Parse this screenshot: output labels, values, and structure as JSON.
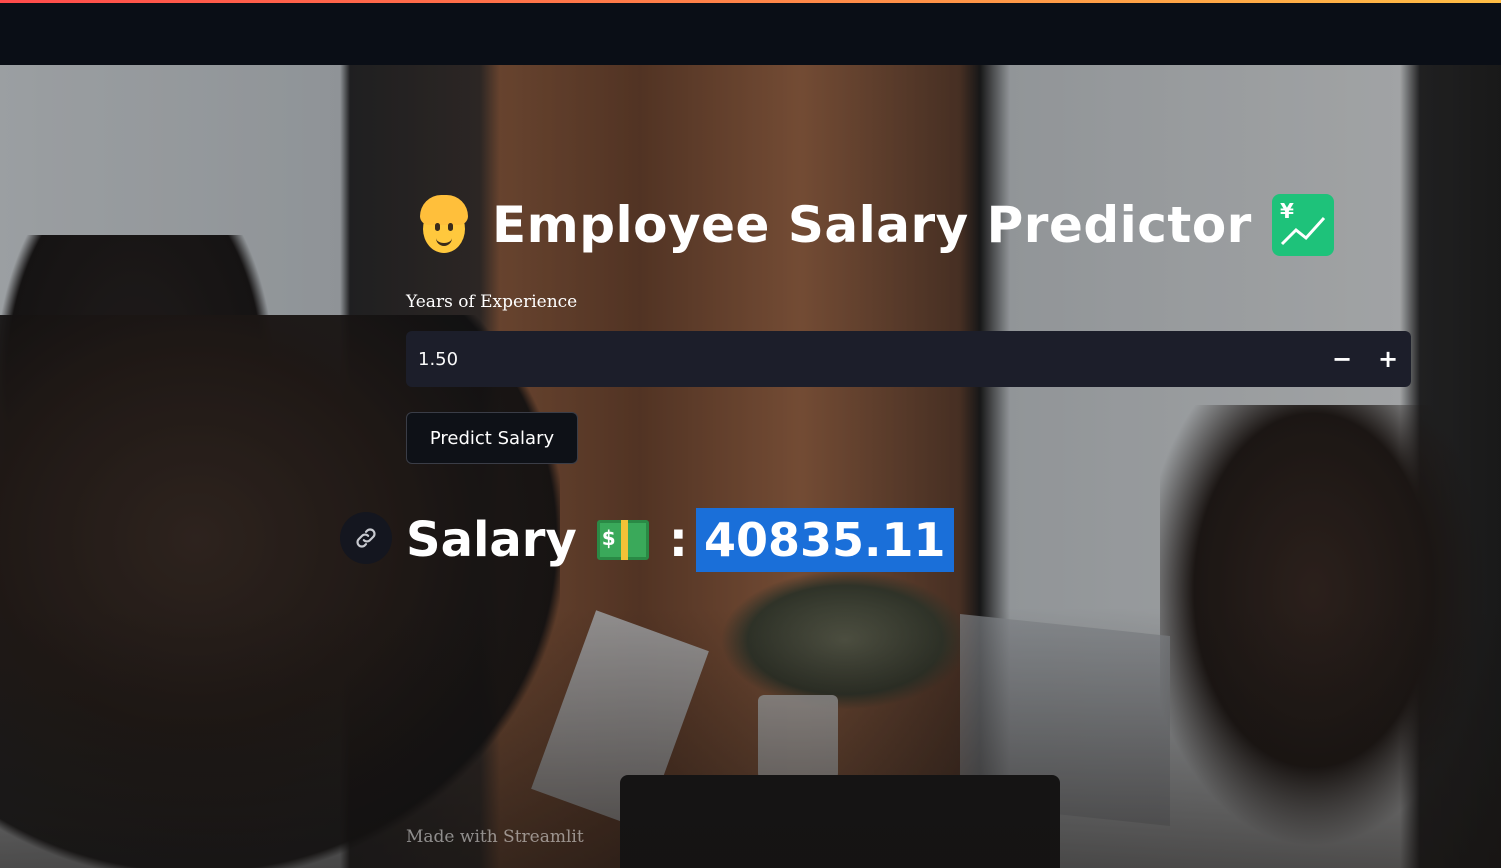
{
  "app": {
    "title": "Employee Salary Predictor",
    "title_icon_left": "person-blond-emoji",
    "title_icon_right": "chart-yen-emoji",
    "accent_colors": [
      "#ff4b4b",
      "#ffbd45"
    ]
  },
  "form": {
    "experience_label": "Years of Experience",
    "experience_value": "1.50",
    "decrement_label": "−",
    "increment_label": "+",
    "predict_button_label": "Predict Salary"
  },
  "result": {
    "label": "Salary",
    "money_icon": "money-bill-emoji",
    "separator": ":",
    "value": "40835.11",
    "highlight_color": "#1a6fd9"
  },
  "footer": {
    "text": "Made with Streamlit"
  }
}
